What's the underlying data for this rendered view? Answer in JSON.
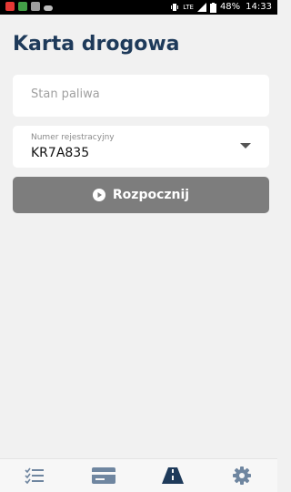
{
  "status_bar": {
    "network": "LTE",
    "battery": "48%",
    "time": "14:33"
  },
  "page": {
    "title": "Karta drogowa"
  },
  "fuel_field": {
    "placeholder": "Stan paliwa",
    "value": ""
  },
  "registration_field": {
    "label": "Numer rejestracyjny",
    "value": "KR7A835"
  },
  "start_button": {
    "label": "Rozpocznij"
  },
  "bottom_nav": {
    "items": [
      {
        "icon": "checklist-icon"
      },
      {
        "icon": "card-icon"
      },
      {
        "icon": "road-icon",
        "active": true
      },
      {
        "icon": "gear-icon"
      }
    ]
  },
  "colors": {
    "title": "#1e3a5a",
    "nav_active": "#1e3a5a",
    "nav_inactive": "#6f86a0",
    "button_disabled": "#7d7d7d",
    "background": "#f1f1f1"
  }
}
